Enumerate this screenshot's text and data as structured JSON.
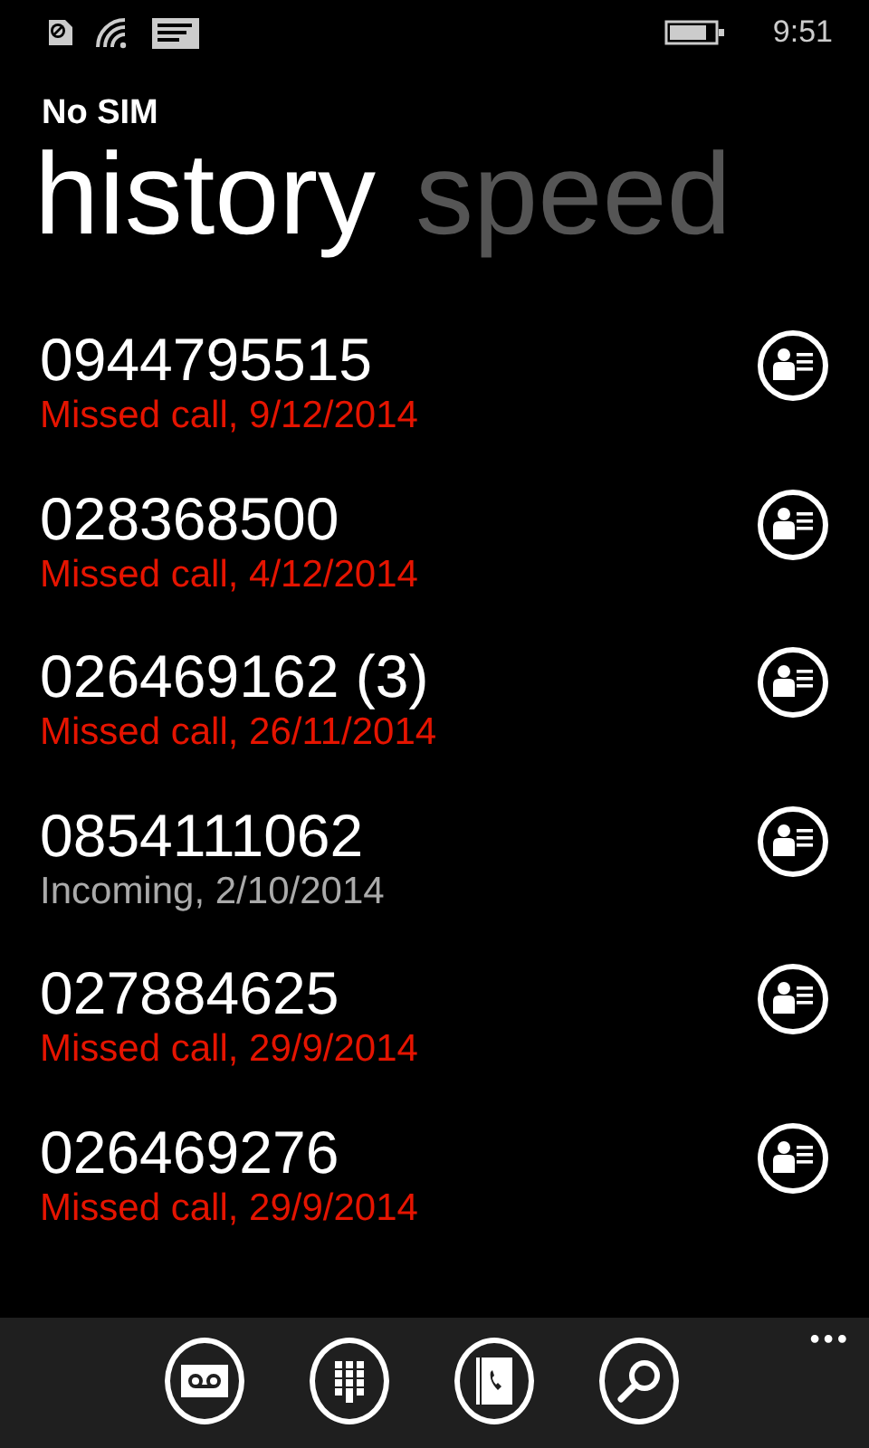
{
  "status_bar": {
    "time": "9:51"
  },
  "carrier": "No SIM",
  "pivots": [
    {
      "label": "history",
      "selected": true
    },
    {
      "label": "speed",
      "selected": false
    }
  ],
  "calls": [
    {
      "number": "0944795515",
      "detail": "Missed call, 9/12/2014",
      "kind": "missed"
    },
    {
      "number": "028368500",
      "detail": "Missed call, 4/12/2014",
      "kind": "missed"
    },
    {
      "number": "026469162 (3)",
      "detail": "Missed call, 26/11/2014",
      "kind": "missed"
    },
    {
      "number": "0854111062",
      "detail": "Incoming, 2/10/2014",
      "kind": "incoming"
    },
    {
      "number": "027884625",
      "detail": "Missed call, 29/9/2014",
      "kind": "missed"
    },
    {
      "number": "026469276",
      "detail": "Missed call, 29/9/2014",
      "kind": "missed"
    }
  ],
  "more": "•••"
}
